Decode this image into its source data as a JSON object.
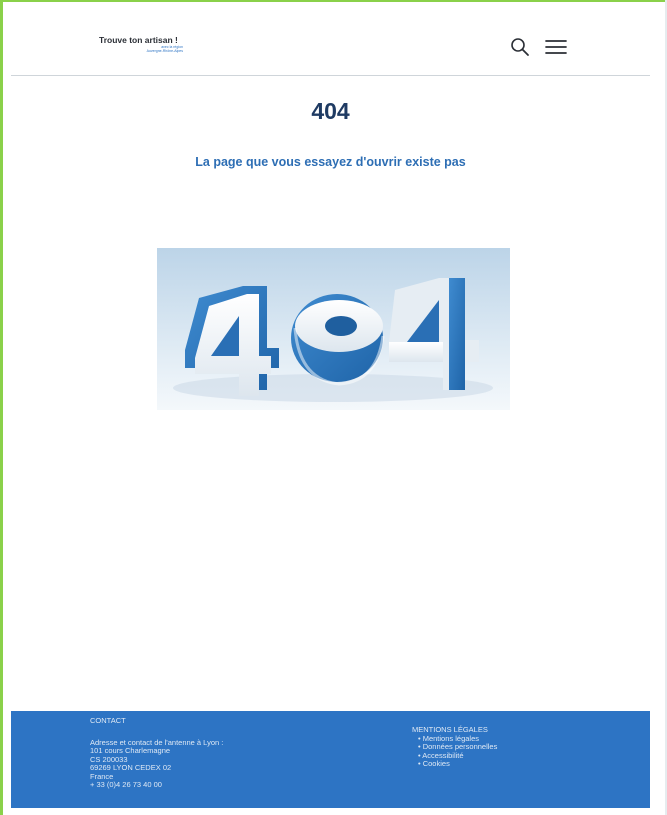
{
  "header": {
    "logo_title": "Trouve ton artisan !",
    "logo_tagline_line1": "avec la région",
    "logo_tagline_line2": "Auvergne-Rhône-Alpes",
    "search_icon": "search-icon",
    "menu_icon": "hamburger-menu-icon"
  },
  "main": {
    "title": "404",
    "message": "La page que vous essayez d'ouvrir existe pas",
    "illustration_text": "404"
  },
  "footer": {
    "contact": {
      "heading": "CONTACT",
      "lines": [
        "Adresse et contact de l'antenne à Lyon :",
        "101 cours Charlemagne",
        "CS 200033",
        "69269 LYON CEDEX 02",
        "France",
        "+ 33 (0)4 26 73 40 00"
      ]
    },
    "legal": {
      "heading": "MENTIONS LÉGALES",
      "links": [
        "Mentions légales",
        "Données personnelles",
        "Accessibilité",
        "Cookies"
      ]
    }
  },
  "colors": {
    "accent": "#2d74c4",
    "title": "#1f3b63",
    "frame": "#8ad14a"
  }
}
